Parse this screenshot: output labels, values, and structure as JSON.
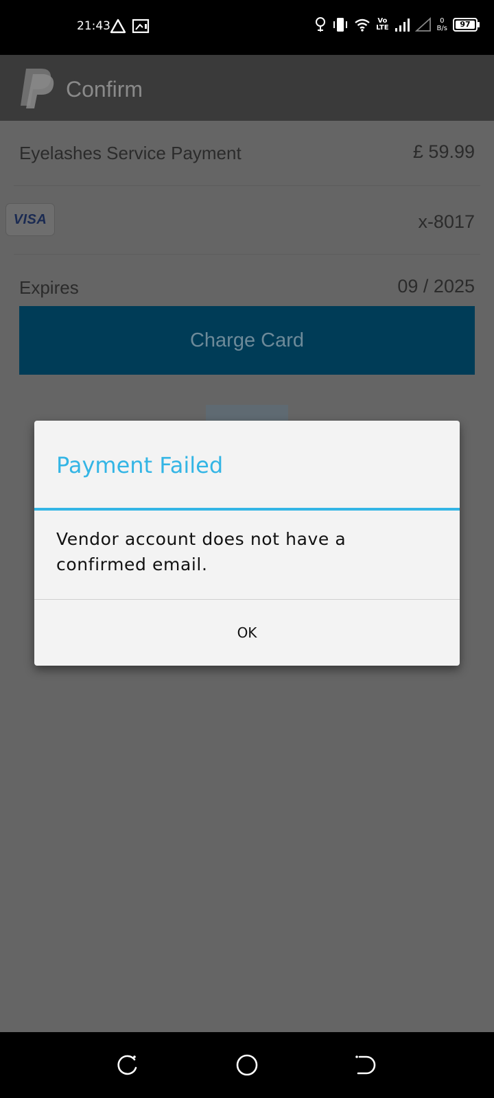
{
  "status_bar": {
    "time": "21:43",
    "net_speed_value": "0",
    "net_speed_unit": "B/s",
    "volte_top": "Vo",
    "volte_bottom": "LTE",
    "battery_level": "97"
  },
  "app_bar": {
    "title": "Confirm"
  },
  "payment": {
    "description": "Eyelashes Service Payment",
    "amount": "£ 59.99",
    "card_brand": "VISA",
    "card_number": "x-8017",
    "expires_label": "Expires",
    "expires_value": "09 / 2025",
    "charge_button_label": "Charge Card"
  },
  "dialog": {
    "title": "Payment Failed",
    "message": "Vendor account does not have a confirmed email.",
    "ok_label": "OK"
  },
  "colors": {
    "dialog_accent": "#33b5e5",
    "charge_button": "#003c57",
    "app_bar": "#3a3a3a"
  },
  "icons": {
    "status_left": [
      "alert-triangle-icon",
      "screen-cast-icon"
    ],
    "status_right": [
      "location-icon",
      "vibrate-icon",
      "wifi-icon",
      "signal-icon",
      "signal-empty-icon",
      "battery-icon"
    ],
    "nav": [
      "recent-apps-icon",
      "home-icon",
      "back-icon"
    ]
  }
}
